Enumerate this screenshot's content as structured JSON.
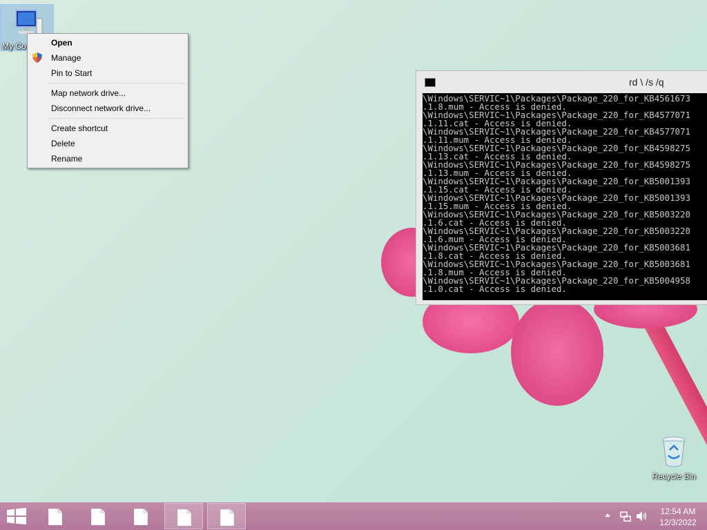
{
  "desktop": {
    "icons": [
      {
        "label": "My Co",
        "icon": "computer-icon"
      },
      {
        "label": "Recycle Bin",
        "icon": "recycle-bin-icon"
      }
    ]
  },
  "context_menu": {
    "items": [
      {
        "label": "Open",
        "bold": true
      },
      {
        "label": "Manage",
        "icon": "uac-shield-icon"
      },
      {
        "label": "Pin to Start"
      },
      {
        "label": "Map network drive..."
      },
      {
        "label": "Disconnect network drive..."
      },
      {
        "label": "Create shortcut"
      },
      {
        "label": "Delete"
      },
      {
        "label": "Rename"
      }
    ]
  },
  "console": {
    "title": "rd \\ /s /q",
    "lines": [
      "\\Windows\\SERVIC~1\\Packages\\Package_220_for_KB4561673",
      ".1.8.mum - Access is denied.",
      "\\Windows\\SERVIC~1\\Packages\\Package_220_for_KB4577071",
      ".1.11.cat - Access is denied.",
      "\\Windows\\SERVIC~1\\Packages\\Package_220_for_KB4577071",
      ".1.11.mum - Access is denied.",
      "\\Windows\\SERVIC~1\\Packages\\Package_220_for_KB4598275",
      ".1.13.cat - Access is denied.",
      "\\Windows\\SERVIC~1\\Packages\\Package_220_for_KB4598275",
      ".1.13.mum - Access is denied.",
      "\\Windows\\SERVIC~1\\Packages\\Package_220_for_KB5001393",
      ".1.15.cat - Access is denied.",
      "\\Windows\\SERVIC~1\\Packages\\Package_220_for_KB5001393",
      ".1.15.mum - Access is denied.",
      "\\Windows\\SERVIC~1\\Packages\\Package_220_for_KB5003220",
      ".1.6.cat - Access is denied.",
      "\\Windows\\SERVIC~1\\Packages\\Package_220_for_KB5003220",
      ".1.6.mum - Access is denied.",
      "\\Windows\\SERVIC~1\\Packages\\Package_220_for_KB5003681",
      ".1.8.cat - Access is denied.",
      "\\Windows\\SERVIC~1\\Packages\\Package_220_for_KB5003681",
      ".1.8.mum - Access is denied.",
      "\\Windows\\SERVIC~1\\Packages\\Package_220_for_KB5004958",
      ".1.0.cat - Access is denied."
    ]
  },
  "taskbar": {
    "buttons": [
      {
        "icon": "document-icon",
        "active": false
      },
      {
        "icon": "document-icon",
        "active": false
      },
      {
        "icon": "document-icon",
        "active": false
      },
      {
        "icon": "document-icon",
        "active": true
      },
      {
        "icon": "document-icon",
        "active": true
      }
    ],
    "clock": {
      "time": "12:54 AM",
      "date": "12/3/2022"
    },
    "tray_icons": [
      "show-hidden-icons-chevron",
      "network-icon",
      "volume-icon"
    ]
  },
  "colors": {
    "accent_petal": "#e0457e",
    "taskbar": "#b97fa0"
  }
}
